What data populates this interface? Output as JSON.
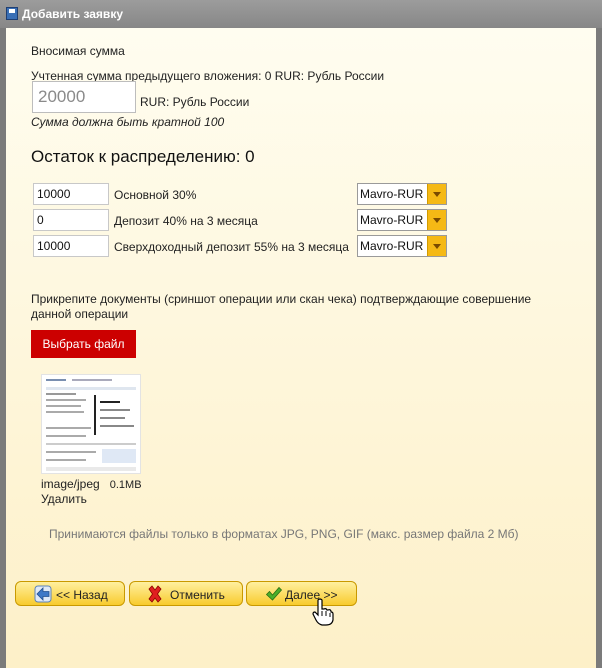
{
  "window": {
    "title": "Добавить заявку"
  },
  "contribution": {
    "heading": "Вносимая сумма",
    "previous_text": "Учтенная сумма предыдущего вложения: 0 RUR: Рубль России",
    "amount_value": "20000",
    "currency_label": "RUR: Рубль России",
    "hint": "Сумма должна быть кратной 100"
  },
  "remainder": {
    "text": "Остаток к распределению: 0"
  },
  "rows": [
    {
      "value": "10000",
      "label": "Основной 30%",
      "currency": "Mavro-RUR"
    },
    {
      "value": "0",
      "label": "Депозит 40% на 3 месяца",
      "currency": "Mavro-RUR"
    },
    {
      "value": "10000",
      "label": "Сверхдоходный депозит 55% на 3 месяца",
      "currency": "Mavro-RUR"
    }
  ],
  "attach": {
    "line1": "Прикрепите документы (сриншот операции или скан чека) подтверждающие совершение",
    "line2": "данной операции",
    "choose_button": "Выбрать файл",
    "file_type": "image/jpeg",
    "file_size": "0.1MB",
    "delete_link": "Удалить",
    "formats_note": "Принимаются файлы только в форматах JPG, PNG, GIF (макс. размер файла 2 Мб)"
  },
  "buttons": {
    "back": "<< Назад",
    "cancel": "Отменить",
    "next": "Далее >>"
  },
  "icons": {
    "window": "save-icon",
    "back": "arrow-left-icon",
    "cancel": "x-mark-icon",
    "next": "checkmark-icon",
    "cursor": "hand-pointer-icon"
  },
  "colors": {
    "title_bar": "#8f8f8f",
    "panel": "#fdf3d2",
    "choose_button": "#cc0000",
    "action_button": "#f8cb2e",
    "select_arrow": "#f5b915"
  }
}
